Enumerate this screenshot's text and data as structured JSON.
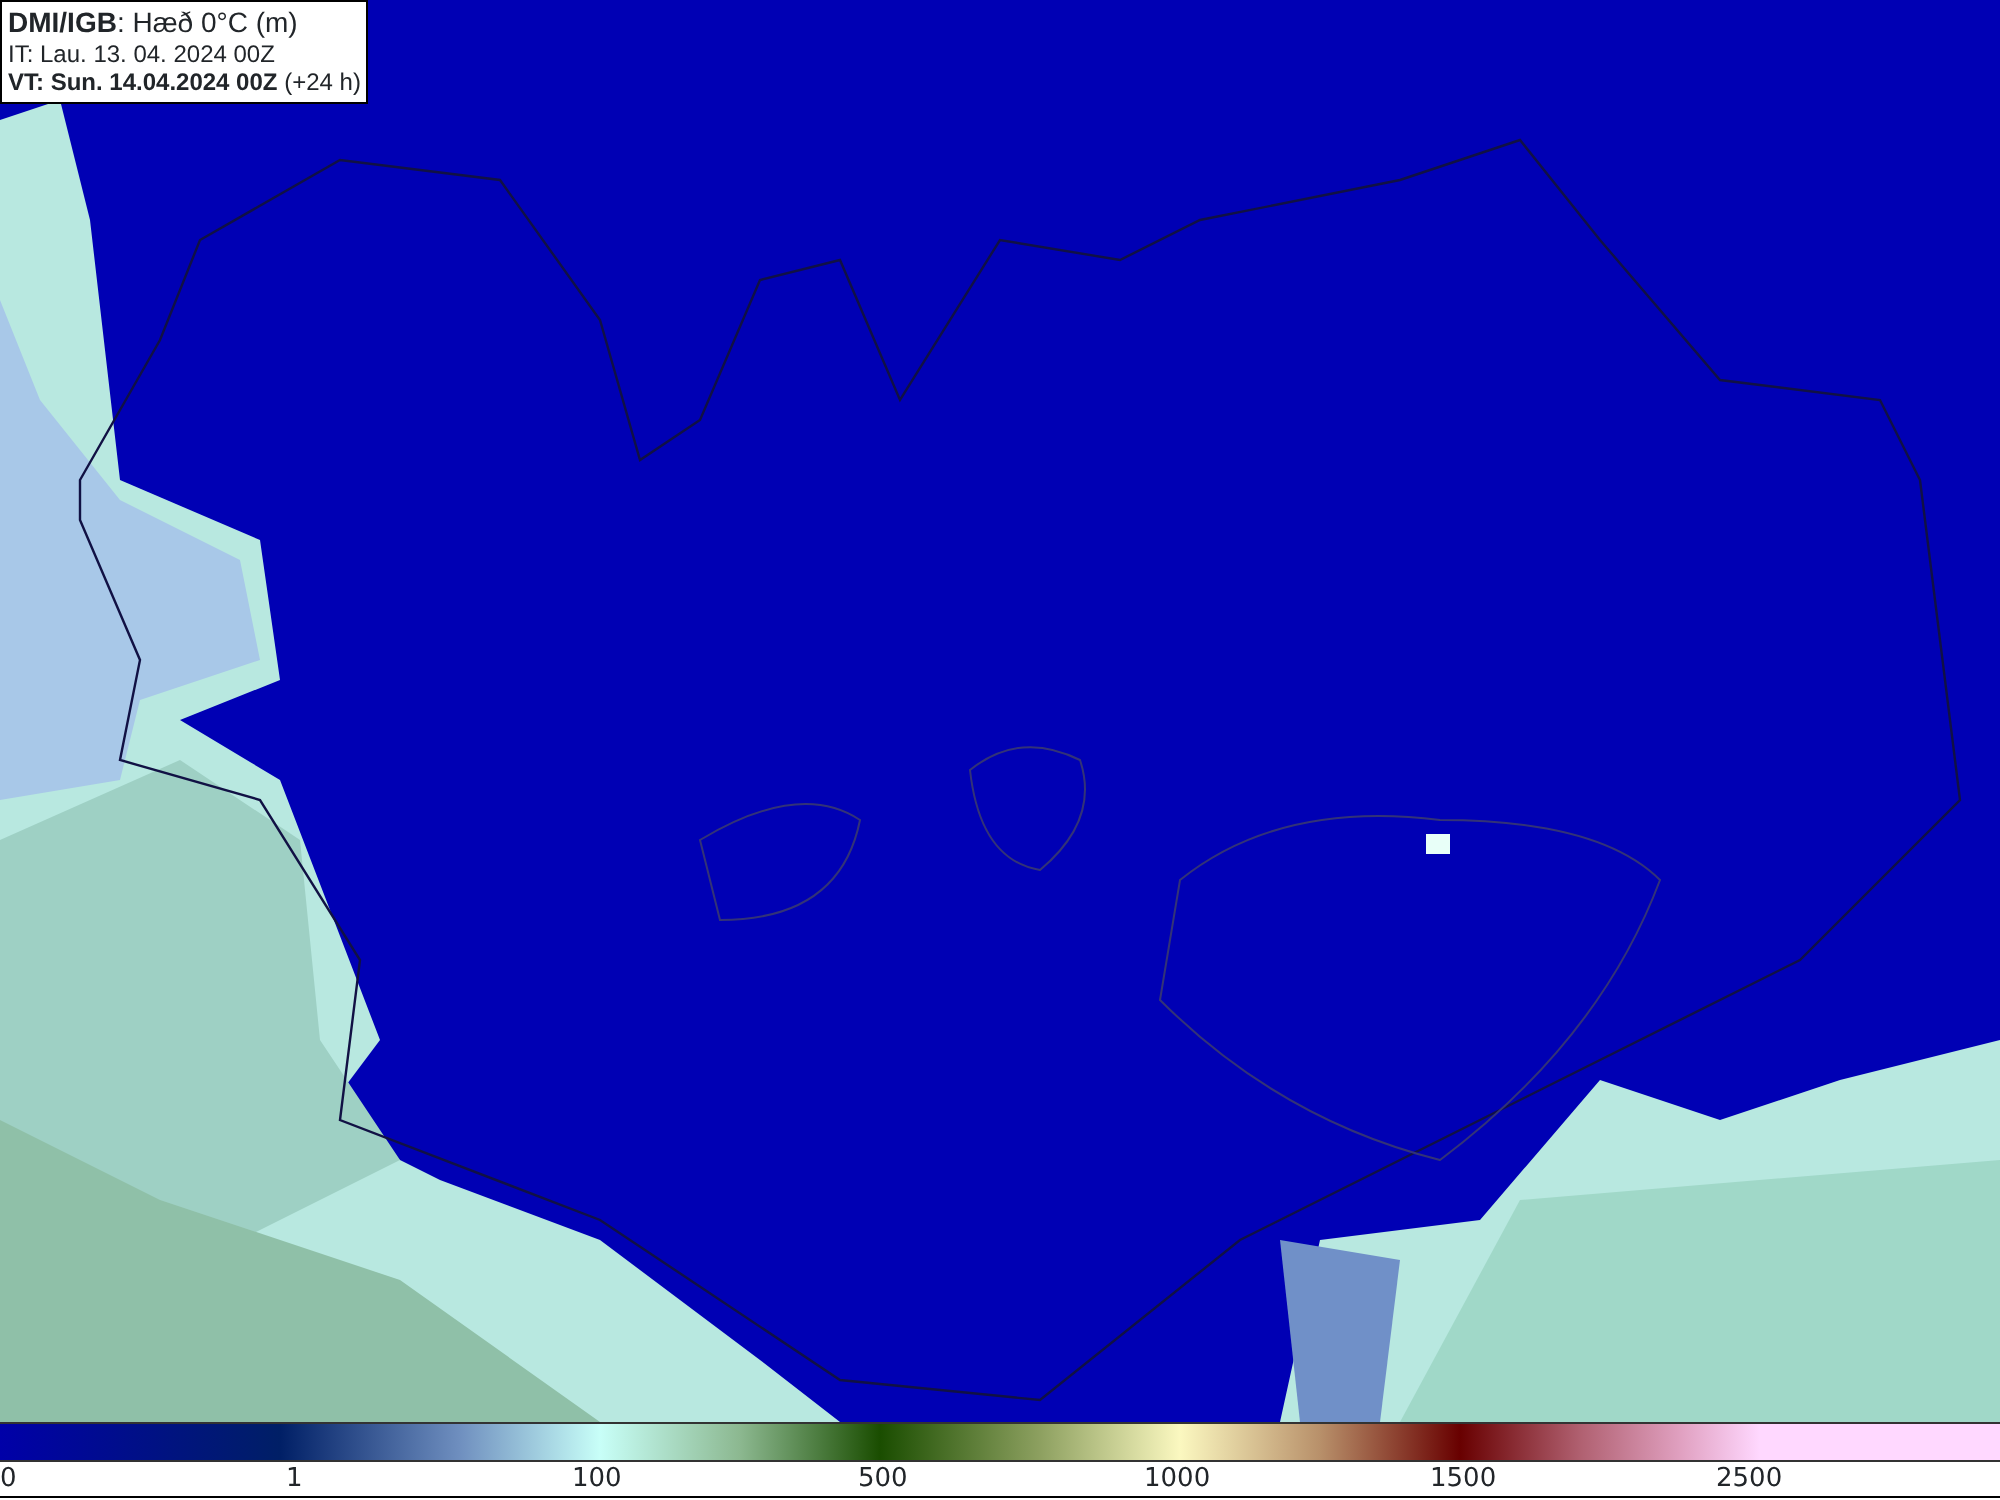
{
  "header": {
    "title": "**DMI/IGB**: Hæð 0°C (m)",
    "init_time": "IT: Lau. 13. 04. 2024 00Z",
    "valid_time": "**VT: Sun. 14.04.2024 00Z** (+24 h)"
  },
  "legend": {
    "ticks": [
      "0",
      "1",
      "100",
      "500",
      "1000",
      "1500",
      "2500"
    ]
  }
}
